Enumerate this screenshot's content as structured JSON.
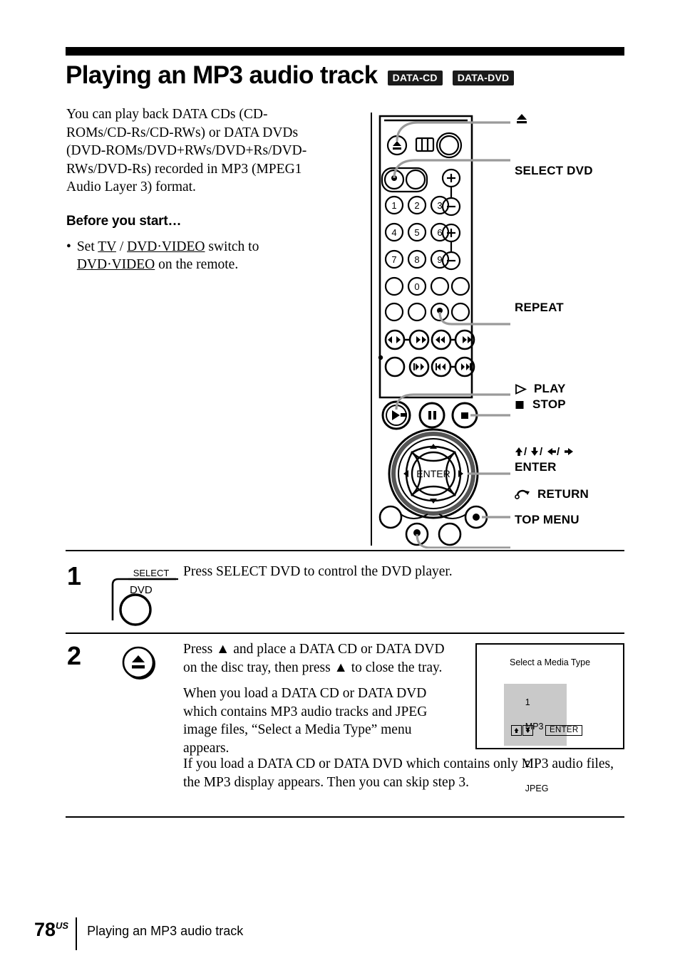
{
  "header": {
    "title": "Playing an MP3 audio track",
    "badges": [
      "DATA-CD",
      "DATA-DVD"
    ]
  },
  "intro": {
    "paragraph": "You can play back DATA CDs (CD-ROMs/CD-Rs/CD-RWs) or DATA DVDs (DVD-ROMs/DVD+RWs/DVD+Rs/DVD-RWs/DVD-Rs) recorded in MP3 (MPEG1 Audio Layer 3) format.",
    "before_heading": "Before you start…",
    "bullet_marker": "•",
    "bullet_pre": "Set ",
    "bullet_link1": "TV",
    "bullet_sep": " / ",
    "bullet_link2": "DVD·VIDEO",
    "bullet_mid": " switch to ",
    "bullet_link3": "DVD·VIDEO",
    "bullet_post": " on the remote."
  },
  "figure": {
    "callouts": [
      {
        "symbol": "▲",
        "label": ""
      },
      {
        "symbol": "",
        "label": "SELECT DVD"
      },
      {
        "symbol": "",
        "label": "REPEAT"
      },
      {
        "symbol": "▷",
        "label": "PLAY"
      },
      {
        "symbol": "■",
        "label": "STOP"
      },
      {
        "symbol": "",
        "label": "⬆/⬇/⬅/➡"
      },
      {
        "symbol": "",
        "label": "ENTER"
      },
      {
        "symbol": "↶",
        "label": "RETURN"
      },
      {
        "symbol": "",
        "label": "TOP MENU"
      }
    ],
    "arrow_keys_label": "♦/♦/♦/♦",
    "enter_label": "ENTER",
    "dpad_center": "ENTER",
    "keypad": [
      "1",
      "2",
      "3",
      "4",
      "5",
      "6",
      "7",
      "8",
      "9",
      "0"
    ],
    "volume_plus": "+",
    "volume_minus": "−"
  },
  "steps": [
    {
      "number": "1",
      "icon": {
        "top_label": "SELECT",
        "sub_label": "DVD",
        "name": "select-dvd-button-icon"
      },
      "paragraphs": [
        "Press SELECT DVD to control the DVD player."
      ]
    },
    {
      "number": "2",
      "icon": {
        "name": "eject-button-icon"
      },
      "paragraphs": [
        "Press ▲ and place a DATA CD or DATA DVD on the disc tray, then press ▲ to close the tray.",
        "When you load a DATA CD or DATA DVD which contains MP3 audio tracks and JPEG image files, “Select a Media Type” menu appears.",
        "If you load a DATA CD or DATA DVD which contains only MP3 audio files, the MP3 display appears. Then you can skip step 3."
      ]
    }
  ],
  "media_screen": {
    "title": "Select a Media Type",
    "items": [
      {
        "number": "1",
        "label": "MP3",
        "selected": true
      },
      {
        "number": "2",
        "label": "JPEG",
        "selected": false
      }
    ],
    "arrow_up": "⬆",
    "arrow_down": "⬇",
    "enter_label": "ENTER"
  },
  "footer": {
    "page_number": "78",
    "page_suffix": "US",
    "section_title": "Playing an MP3 audio track"
  }
}
